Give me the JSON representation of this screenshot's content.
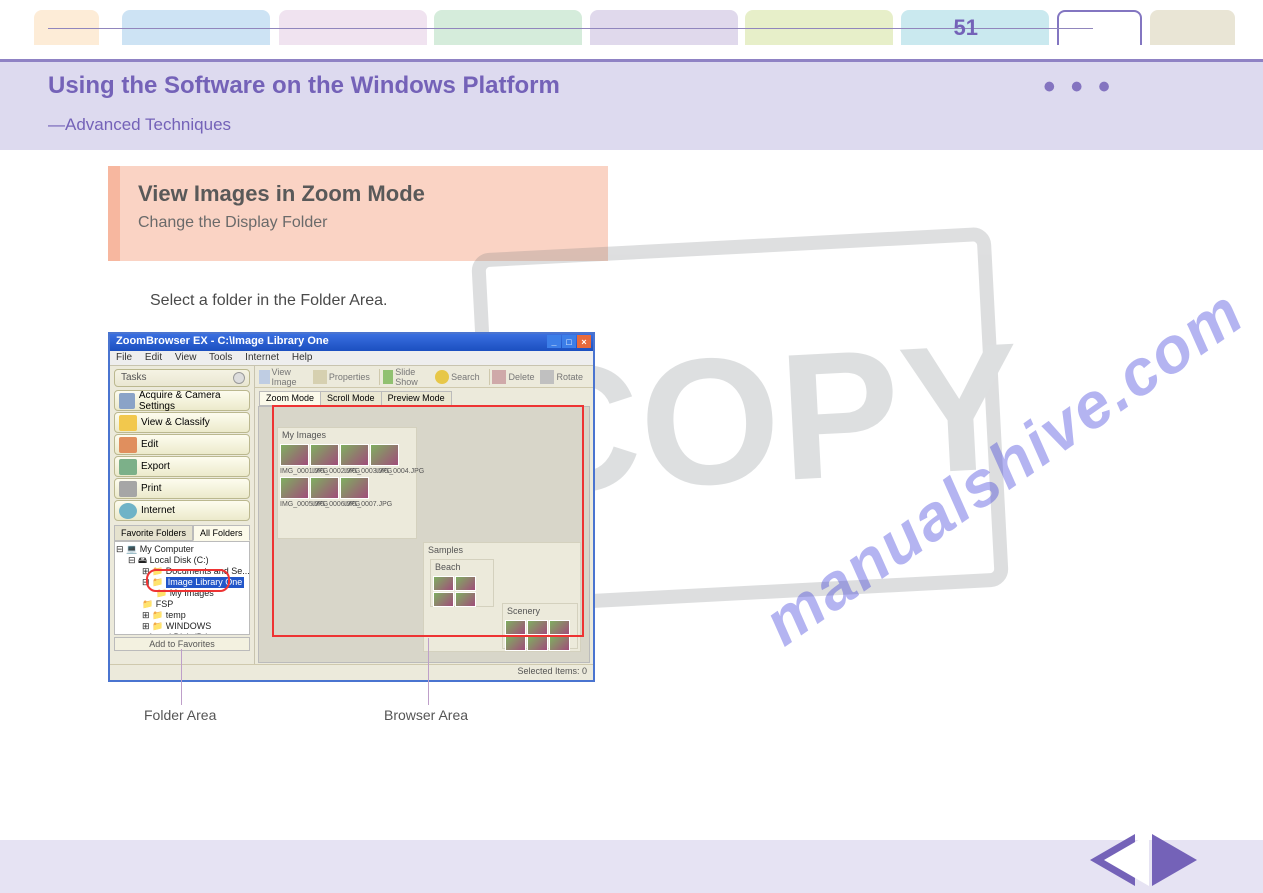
{
  "tabs": [
    "",
    "",
    "",
    "",
    "",
    "",
    "",
    "",
    ""
  ],
  "header": {
    "title": "Using the Software on the Windows Platform",
    "subtitle": "—Advanced Techniques",
    "dots": "• • •"
  },
  "heading": {
    "title": "View Images in Zoom Mode",
    "subtitle": "Change the Display Folder"
  },
  "step": "Select a folder in the Folder Area.",
  "zb": {
    "title": "ZoomBrowser EX  -  C:\\Image Library One",
    "menu": [
      "File",
      "Edit",
      "View",
      "Tools",
      "Internet",
      "Help"
    ],
    "tasks_label": "Tasks",
    "tasks": [
      {
        "icon": "cam",
        "label": "Acquire & Camera Settings"
      },
      {
        "icon": "fold",
        "label": "View & Classify"
      },
      {
        "icon": "edit",
        "label": "Edit"
      },
      {
        "icon": "exp",
        "label": "Export"
      },
      {
        "icon": "prn",
        "label": "Print"
      },
      {
        "icon": "net",
        "label": "Internet"
      }
    ],
    "fav_tabs": {
      "left": "Favorite Folders",
      "right": "All Folders"
    },
    "tree": {
      "root": "My Computer",
      "n1": "Local Disk (C:)",
      "n2a": "Documents and Se...",
      "n2_hl": "Image Library One",
      "n3a": "My Images",
      "n3b": "FSP",
      "n3c": "temp",
      "n3d": "WINDOWS",
      "n1b": "Local Disk (D:)"
    },
    "add_fav": "Add to Favorites",
    "toolbar": {
      "view": "View Image",
      "prop": "Properties",
      "slide": "Slide Show",
      "search": "Search",
      "delete": "Delete",
      "rotate": "Rotate"
    },
    "modetabs": [
      "Zoom Mode",
      "Scroll Mode",
      "Preview Mode"
    ],
    "folders": {
      "f1": {
        "label": "My Images",
        "caps": [
          "IMG_0001.JPG",
          "IMG_0002.JPG",
          "IMG_0003.JPG",
          "IMG_0004.JPG",
          "IMG_0005.JPG",
          "IMG_0006.JPG",
          "IMG_0007.JPG"
        ]
      },
      "f2": {
        "label": "Samples",
        "sub_beach": "Beach",
        "sub_scenery": "Scenery"
      }
    },
    "status": "Selected Items: 0"
  },
  "callouts": {
    "folder_area": "Folder Area",
    "browser_area": "Browser Area"
  },
  "watermark": "manualshive.com",
  "copy_stamp": [
    "C",
    "O",
    "P",
    "Y"
  ],
  "footer": {
    "page": "51"
  }
}
